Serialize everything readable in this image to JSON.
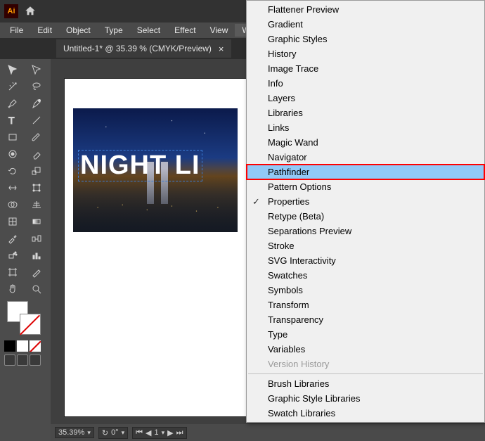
{
  "titlebar": {
    "app": "Ai"
  },
  "menubar": [
    "File",
    "Edit",
    "Object",
    "Type",
    "Select",
    "Effect",
    "View",
    "Window"
  ],
  "menubar_active": 7,
  "tab": {
    "label": "Untitled-1* @ 35.39 % (CMYK/Preview)"
  },
  "canvas": {
    "text": "NIGHT LI"
  },
  "statusbar": {
    "zoom": "35.39%",
    "rotate": "0°",
    "artboard": "1"
  },
  "dropdown": {
    "items": [
      {
        "label": "Flattener Preview",
        "checked": false
      },
      {
        "label": "Gradient",
        "checked": false
      },
      {
        "label": "Graphic Styles",
        "checked": false
      },
      {
        "label": "History",
        "checked": false
      },
      {
        "label": "Image Trace",
        "checked": false
      },
      {
        "label": "Info",
        "checked": false
      },
      {
        "label": "Layers",
        "checked": false
      },
      {
        "label": "Libraries",
        "checked": false
      },
      {
        "label": "Links",
        "checked": false
      },
      {
        "label": "Magic Wand",
        "checked": false
      },
      {
        "label": "Navigator",
        "checked": false
      },
      {
        "label": "Pathfinder",
        "checked": false,
        "highlight": true
      },
      {
        "label": "Pattern Options",
        "checked": false
      },
      {
        "label": "Properties",
        "checked": true
      },
      {
        "label": "Retype (Beta)",
        "checked": false
      },
      {
        "label": "Separations Preview",
        "checked": false
      },
      {
        "label": "Stroke",
        "checked": false
      },
      {
        "label": "SVG Interactivity",
        "checked": false
      },
      {
        "label": "Swatches",
        "checked": false
      },
      {
        "label": "Symbols",
        "checked": false
      },
      {
        "label": "Transform",
        "checked": false
      },
      {
        "label": "Transparency",
        "checked": false
      },
      {
        "label": "Type",
        "checked": false
      },
      {
        "label": "Variables",
        "checked": false
      },
      {
        "label": "Version History",
        "checked": false,
        "disabled": true
      },
      {
        "sep": true
      },
      {
        "label": "Brush Libraries",
        "checked": false
      },
      {
        "label": "Graphic Style Libraries",
        "checked": false
      },
      {
        "label": "Swatch Libraries",
        "checked": false
      }
    ]
  }
}
